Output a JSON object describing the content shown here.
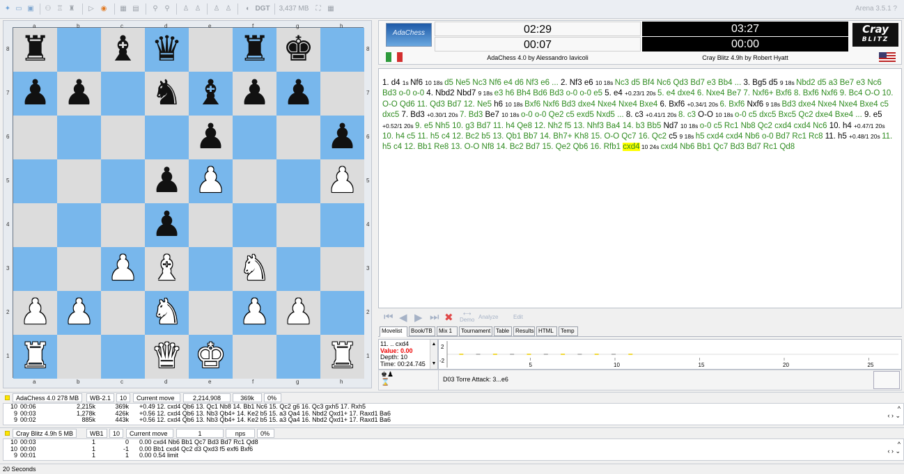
{
  "toolbar": {
    "memory": "3,437 MB",
    "arena": "Arena 3.5.1"
  },
  "board": {
    "files": [
      "a",
      "b",
      "c",
      "d",
      "e",
      "f",
      "g",
      "h"
    ],
    "ranks": [
      "8",
      "7",
      "6",
      "5",
      "4",
      "3",
      "2",
      "1"
    ],
    "position": [
      [
        "br",
        "",
        "bb",
        "bq",
        "",
        "br",
        "bk",
        ""
      ],
      [
        "bp",
        "bp",
        "",
        "bn",
        "bb",
        "bp",
        "bp",
        ""
      ],
      [
        "",
        "",
        "",
        "",
        "bp",
        "",
        "",
        "bp"
      ],
      [
        "",
        "",
        "",
        "bp",
        "wp",
        "",
        "",
        "wp"
      ],
      [
        "",
        "",
        "",
        "bp",
        "",
        "",
        "",
        ""
      ],
      [
        "",
        "",
        "wp",
        "wb",
        "",
        "wn",
        "",
        ""
      ],
      [
        "wp",
        "wp",
        "",
        "wn",
        "",
        "wp",
        "wp",
        ""
      ],
      [
        "wr",
        "",
        "",
        "wq",
        "wk",
        "",
        "",
        "wr"
      ]
    ],
    "colors": {
      "light": "#dcdcdc",
      "dark": "#78b7ec"
    }
  },
  "clocks": {
    "white_total": "02:29",
    "white_move": "00:07",
    "white_engine": "AdaChess 4.0 by Alessandro Iavicoli",
    "black_total": "03:27",
    "black_move": "00:00",
    "black_engine": "Cray Blitz 4.9h by Robert Hyatt",
    "logo_left": "AdaChess",
    "logo_right_1": "Cray",
    "logo_right_2": "BLITZ"
  },
  "movelist": [
    {
      "t": "1. d4 ",
      "c": "k"
    },
    {
      "t": "1s ",
      "c": "e"
    },
    {
      "t": "Nf6 ",
      "c": "k"
    },
    {
      "t": "10 18s ",
      "c": "e"
    },
    {
      "t": "d5 Ne5 Nc3 Nf6 e4 d6 Nf3 e6 ... ",
      "c": "g"
    },
    {
      "t": "2. Nf3 e6 ",
      "c": "k"
    },
    {
      "t": "10 18s ",
      "c": "e"
    },
    {
      "t": "Nc3 d5 Bf4 Nc6 Qd3 Bd7 e3 Bb4 ... ",
      "c": "g"
    },
    {
      "t": "3. Bg5 d5 ",
      "c": "k"
    },
    {
      "t": "9 18s ",
      "c": "e"
    },
    {
      "t": "Nbd2 d5 a3 Be7 e3 Nc6 Bd3 o-0 o-0 ",
      "c": "g"
    },
    {
      "t": "4. Nbd2 Nbd7 ",
      "c": "k"
    },
    {
      "t": "9 18s ",
      "c": "e"
    },
    {
      "t": "e3 h6 Bh4 Bd6 Bd3 o-0 o-0 e5 ",
      "c": "g"
    },
    {
      "t": "5. e4 ",
      "c": "k"
    },
    {
      "t": "+0.23/1 20s ",
      "c": "e"
    },
    {
      "t": "5. e4 dxe4 6. Nxe4 Be7 7. Nxf6+ Bxf6 8. Bxf6 Nxf6 9. Bc4 O-O 10. O-O Qd6 11. Qd3 Bd7 12. Ne5 ",
      "c": "g"
    },
    {
      "t": "h6 ",
      "c": "k"
    },
    {
      "t": "10 18s ",
      "c": "e"
    },
    {
      "t": "Bxf6 Nxf6 Bd3 dxe4 Nxe4 Nxe4 Bxe4 ",
      "c": "g"
    },
    {
      "t": "6. Bxf6 ",
      "c": "k"
    },
    {
      "t": "+0.34/1 20s ",
      "c": "e"
    },
    {
      "t": "6. Bxf6 ",
      "c": "g"
    },
    {
      "t": "Nxf6 ",
      "c": "k"
    },
    {
      "t": "9 18s ",
      "c": "e"
    },
    {
      "t": "Bd3 dxe4 Nxe4 Nxe4 Bxe4 c5 dxc5 ",
      "c": "g"
    },
    {
      "t": "7. Bd3 ",
      "c": "k"
    },
    {
      "t": "+0.30/1 20s ",
      "c": "e"
    },
    {
      "t": "7. Bd3 ",
      "c": "g"
    },
    {
      "t": "Be7 ",
      "c": "k"
    },
    {
      "t": "10 18s ",
      "c": "e"
    },
    {
      "t": "o-0 o-0 Qe2 c5 exd5 Nxd5 ... ",
      "c": "g"
    },
    {
      "t": "8. c3 ",
      "c": "k"
    },
    {
      "t": "+0.41/1 20s ",
      "c": "e"
    },
    {
      "t": "8. c3 ",
      "c": "g"
    },
    {
      "t": "O-O ",
      "c": "k"
    },
    {
      "t": "10 18s ",
      "c": "e"
    },
    {
      "t": "o-0 c5 dxc5 Bxc5 Qc2 dxe4 Bxe4 ... ",
      "c": "g"
    },
    {
      "t": "9. e5 ",
      "c": "k"
    },
    {
      "t": "+0.52/1 20s ",
      "c": "e"
    },
    {
      "t": "9. e5 Nh5 10. g3 Bd7 11. h4 Qe8 12. Nh2 f5 13. Nhf3 Ba4 14. b3 Bb5 ",
      "c": "g"
    },
    {
      "t": "Nd7 ",
      "c": "k"
    },
    {
      "t": "10 18s ",
      "c": "e"
    },
    {
      "t": "o-0 c5 Rc1 Nb8 Qc2 cxd4 cxd4 Nc6 ",
      "c": "g"
    },
    {
      "t": "10. h4 ",
      "c": "k"
    },
    {
      "t": "+0.47/1 20s ",
      "c": "e"
    },
    {
      "t": "10. h4 c5 11. h5 c4 12. Bc2 b5 13. Qb1 Bb7 14. Bh7+ Kh8 15. O-O Qc7 16. Qc2 ",
      "c": "g"
    },
    {
      "t": "c5 ",
      "c": "k"
    },
    {
      "t": "9 18s ",
      "c": "e"
    },
    {
      "t": "h5 cxd4 cxd4 Nb6 o-0 Bd7 Rc1 Rc8 ",
      "c": "g"
    },
    {
      "t": "11. h5 ",
      "c": "k"
    },
    {
      "t": "+0.48/1 20s ",
      "c": "e"
    },
    {
      "t": "11. h5 c4 12. Bb1 Re8 13. O-O Nf8 14. Bc2 Bd7 15. Qe2 Qb6 16. Rfb1 ",
      "c": "g"
    },
    {
      "t": "cxd4",
      "c": "h"
    },
    {
      "t": " 10 24s ",
      "c": "e"
    },
    {
      "t": "cxd4 Nb6 Bb1 Qc7 Bd3 Bd7 Rc1 Qd8",
      "c": "g"
    }
  ],
  "nav": {
    "analyze": "Analyze",
    "demo": "Demo",
    "edit": "Edit"
  },
  "tabs": [
    "Movelist",
    "Book/TB",
    "Mix 1",
    "Tournament",
    "Table",
    "Results",
    "HTML",
    "Temp"
  ],
  "eval": {
    "move": "11. .. cxd4",
    "value": "Value: 0.00",
    "depth": "Depth: 10",
    "time": "Time: 00:24.745"
  },
  "graph": {
    "x_ticks": [
      "5",
      "10",
      "15",
      "20",
      "25"
    ],
    "y_ticks": [
      "2",
      "-2"
    ]
  },
  "opening": "D03  Torre Attack: 3...e6",
  "engine1": {
    "name": "AdaChess 4.0",
    "mem": "278 MB",
    "book": "WB-2.1",
    "depth": "10",
    "label": "Current move",
    "nodes": "2,214,908",
    "nps": "369k",
    "pct": "0%",
    "rows": [
      [
        "10",
        "00:06",
        "2,215k",
        "369k",
        "+0.49  12. cxd4 Qb6 13. Qc1 Nb8 14. Bb1 Nc6 15. Qc2 g6 16. Qc3 gxh5 17. Rxh5"
      ],
      [
        "9",
        "00:03",
        "1,278k",
        "426k",
        "+0.56  12. cxd4 Qb6 13. Nb3 Qb4+ 14. Ke2 b5 15. a3 Qa4 16. Nbd2 Qxd1+ 17. Raxd1 Ba6"
      ],
      [
        "9",
        "00:02",
        "885k",
        "443k",
        "+0.56  12. cxd4 Qb6 13. Nb3 Qb4+ 14. Ke2 b5 15. a3 Qa4 16. Nbd2 Qxd1+ 17. Raxd1 Ba6"
      ]
    ]
  },
  "engine2": {
    "name": "Cray Blitz 4.9h",
    "mem": "5 MB",
    "book": "WB1",
    "depth": "10",
    "label": "Current move",
    "nodes": "1",
    "nps": "nps",
    "pct": "0%",
    "rows": [
      [
        "10",
        "00:03",
        "1",
        "0",
        "0.00  cxd4 Nb6 Bb1 Qc7 Bd3 Bd7 Rc1 Qd8"
      ],
      [
        "10",
        "00:00",
        "1",
        "-1",
        "0.00  Bb1 cxd4 Qc2 d3 Qxd3 f5 exf6 Bxf6"
      ],
      [
        "9",
        "00:01",
        "1",
        "1",
        "0.00  0.54 limit"
      ]
    ]
  },
  "status": "20 Seconds"
}
